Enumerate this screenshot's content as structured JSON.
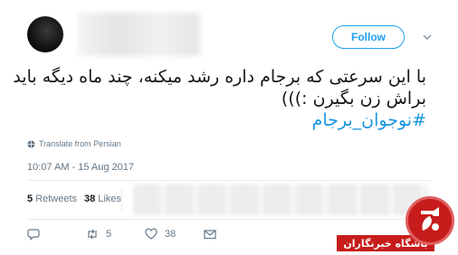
{
  "header": {
    "follow_label": "Follow"
  },
  "tweet": {
    "text_lines": [
      "با این سرعتی که برجام داره رشد میکنه، چند ماه دیگه باید",
      "براش زن بگیرن :)))",
      "#نوجوان_برجام"
    ],
    "translate_label": "Translate from Persian",
    "timestamp": "10:07 AM - 15 Aug 2017"
  },
  "stats": {
    "retweets_count": "5",
    "retweets_label": "Retweets",
    "likes_count": "38",
    "likes_label": "Likes"
  },
  "actions": {
    "reply_icon": "reply-icon",
    "retweet_count": "5",
    "like_count": "38",
    "dm_icon": "envelope-icon"
  },
  "watermark": {
    "label": "باشگاه خبرنگاران"
  },
  "colors": {
    "accent": "#1da1f2",
    "hashtag": "#1b95e0",
    "muted": "#657786",
    "watermark_red": "#c71c1c"
  }
}
